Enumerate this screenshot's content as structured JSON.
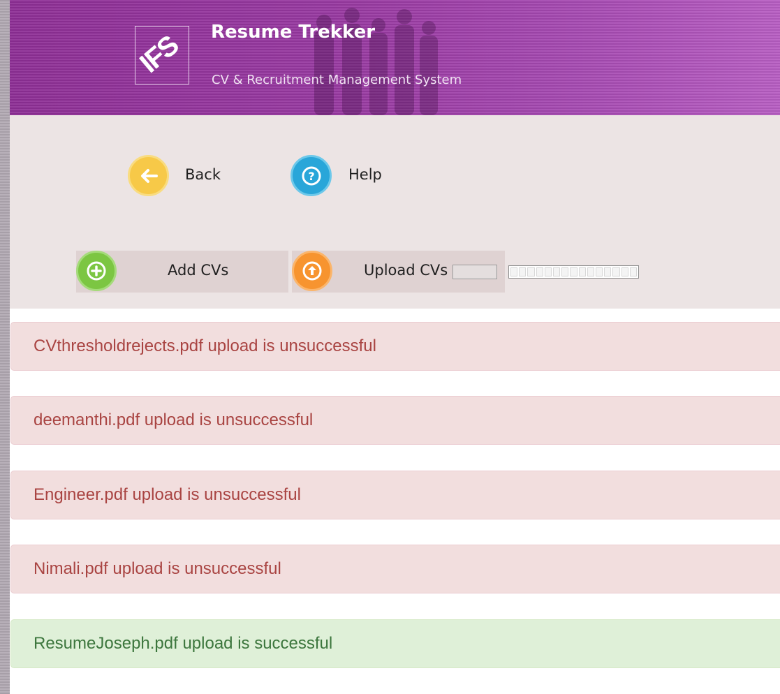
{
  "header": {
    "logo_text": "IFS",
    "title": "Resume Trekker",
    "subtitle": "CV & Recruitment Management System"
  },
  "nav": {
    "back_label": "Back",
    "help_label": "Help"
  },
  "actions": {
    "add_label": "Add CVs",
    "upload_label": "Upload CVs"
  },
  "messages": [
    {
      "text": "CVthresholdrejects.pdf upload is unsuccessful",
      "status": "error"
    },
    {
      "text": "deemanthi.pdf upload is unsuccessful",
      "status": "error"
    },
    {
      "text": "Engineer.pdf upload is unsuccessful",
      "status": "error"
    },
    {
      "text": "Nimali.pdf upload is unsuccessful",
      "status": "error"
    },
    {
      "text": "ResumeJoseph.pdf upload is successful",
      "status": "success"
    }
  ],
  "icons": {
    "back": "arrow-left-icon",
    "help": "question-icon",
    "add": "plus-icon",
    "upload": "upload-arrow-icon"
  },
  "colors": {
    "header_purple": "#993aa2",
    "back_yellow": "#f7c948",
    "help_blue": "#29a6d9",
    "add_green": "#7cc642",
    "upload_orange": "#f7942f",
    "error_text": "#a94442",
    "success_text": "#3c763d"
  }
}
